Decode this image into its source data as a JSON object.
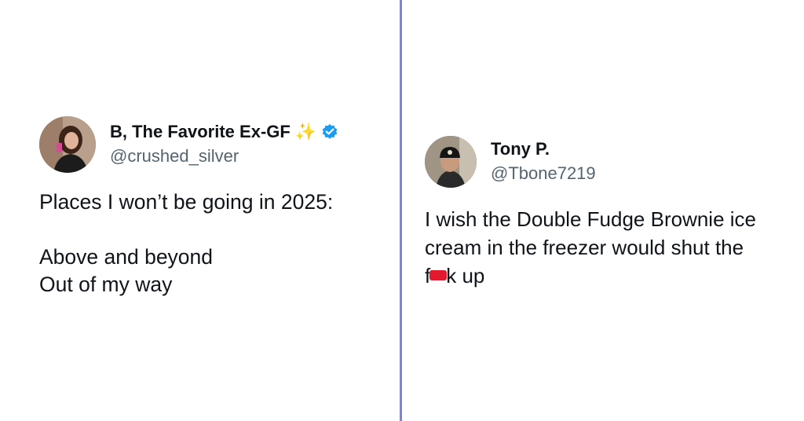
{
  "left_tweet": {
    "display_name": "B, The Favorite Ex-GF",
    "handle": "@crushed_silver",
    "badge_emoji": "✨",
    "verified": true,
    "lines": {
      "l1": "Places I won’t be going in 2025:",
      "l2": "Above and beyond",
      "l3": "Out of my way"
    }
  },
  "right_tweet": {
    "display_name": "Tony P.",
    "handle": "@Tbone7219",
    "lines": {
      "l1": "I wish the Double Fudge Brownie ice",
      "l2": "cream in the freezer would shut the",
      "l3_start": "f",
      "l3_end": "k up"
    }
  },
  "colors": {
    "divider": "#7b7ff0",
    "verified": "#1d9bf0",
    "censor": "#e3192f",
    "handle": "#536471"
  },
  "icons": [
    "sparkles-icon",
    "verified-badge-icon"
  ]
}
